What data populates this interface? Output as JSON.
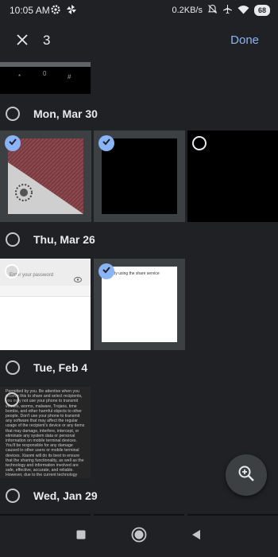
{
  "status_bar": {
    "time": "10:05 AM",
    "network_speed": "0.2KB/s",
    "battery": "68",
    "icons": [
      "settings-icon",
      "pinwheel-icon",
      "bell-off-icon",
      "airplane-icon",
      "wifi-icon",
      "battery-icon"
    ]
  },
  "app_bar": {
    "selected_count": "3",
    "done_label": "Done"
  },
  "groups": [
    {
      "date": "Mon, Mar 30"
    },
    {
      "date": "Thu, Mar 26"
    },
    {
      "date": "Tue, Feb 4"
    },
    {
      "date": "Wed, Jan 29"
    }
  ],
  "thumbnails": {
    "dialpad_keys": [
      "*",
      "0",
      "#"
    ],
    "password_placeholder": "Enter your password",
    "doc_small_text": "By using the share service",
    "disclaimer_text": "Permitted by you. Be attentive when you receive this to share and select recipients, you may not use your phone to transmit viruses, worms, malware, Trojans, time bombs, and other harmful objects to other people. Don't use your phone to transmit any software that may affect the regular usage of the recipient's device or any items that may damage, interfere, intercept, or eliminate any system data or personal information on mobile terminal devices. You'll be responsible for any damage caused to other users or mobile terminal devices. Xiaomi will do its best to ensure that the sharing functionality, as well as the technology and information involved are safe, effective, accurate, and reliable. However, due to the current technology limitations, Xiaomi doesn't guarantee that"
  },
  "colors": {
    "accent": "#8ab4f8",
    "background": "#202124",
    "selected_tile": "#3c4043"
  }
}
